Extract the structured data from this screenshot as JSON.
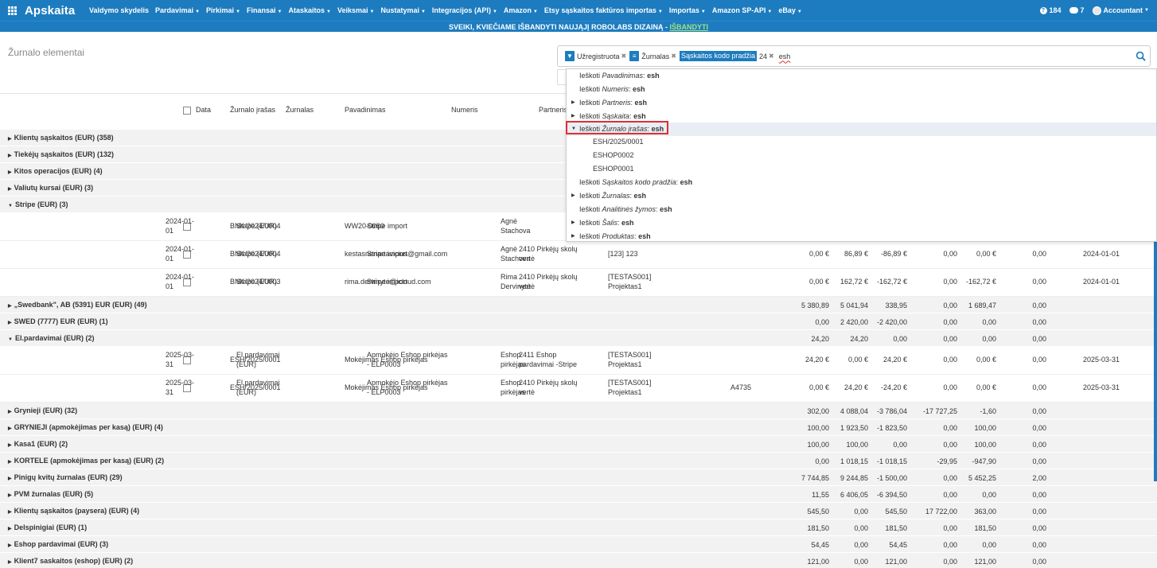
{
  "app": {
    "name": "Apskaita"
  },
  "nav": {
    "items": [
      "Valdymo skydelis",
      "Pardavimai",
      "Pirkimai",
      "Finansai",
      "Ataskaitos",
      "Veiksmai",
      "Nustatymai",
      "Integracijos (API)",
      "Amazon",
      "Etsy sąskaitos faktūros importas",
      "Importas",
      "Amazon SP-API",
      "eBay"
    ],
    "has_caret": [
      false,
      true,
      true,
      true,
      true,
      true,
      true,
      true,
      true,
      true,
      true,
      true,
      true
    ],
    "help_count": "184",
    "messages_count": "7",
    "user": "Accountant"
  },
  "promo": {
    "text": "SVEIKI, KVIEČIAME IŠBANDYTI NAUJĄJĮ ROBOLABS DIZAINĄ - ",
    "link": "IŠBANDYTI"
  },
  "page": {
    "title": "Žurnalo elementai"
  },
  "search": {
    "facets": [
      {
        "icon": "filter-icon",
        "label": "Užregistruota"
      },
      {
        "icon": "list-icon",
        "label": "Žurnalas"
      },
      {
        "icon": "groupby-label",
        "label": "Sąskaitos kodo pradžia",
        "value": "24"
      }
    ],
    "query": "esh"
  },
  "dropdown": {
    "items": [
      {
        "prefix": "Ieškoti ",
        "field": "Pavadinimas",
        "sep": ": ",
        "q": "esh",
        "expandable": false
      },
      {
        "prefix": "Ieškoti ",
        "field": "Numeris",
        "sep": ": ",
        "q": "esh",
        "expandable": false
      },
      {
        "prefix": "Ieškoti ",
        "field": "Partneris",
        "sep": ": ",
        "q": "esh",
        "expandable": true
      },
      {
        "prefix": "Ieškoti ",
        "field": "Sąskaita",
        "sep": ": ",
        "q": "esh",
        "expandable": true
      },
      {
        "prefix": "Ieškoti ",
        "field": "Žurnalo įrašas",
        "sep": ": ",
        "q": "esh",
        "expandable": true,
        "expanded": true,
        "active": true
      },
      {
        "sub": "ESH/2025/0001"
      },
      {
        "sub": "ESHOP0002"
      },
      {
        "sub": "ESHOP0001"
      },
      {
        "prefix": "Ieškoti ",
        "field": "Sąskaitos kodo pradžia",
        "sep": ": ",
        "q": "esh",
        "expandable": false
      },
      {
        "prefix": "Ieškoti ",
        "field": "Žurnalas",
        "sep": ": ",
        "q": "esh",
        "expandable": true
      },
      {
        "prefix": "Ieškoti ",
        "field": "Analitinės žymos",
        "sep": ": ",
        "q": "esh",
        "expandable": false
      },
      {
        "prefix": "Ieškoti ",
        "field": "Šalis",
        "sep": ": ",
        "q": "esh",
        "expandable": true
      },
      {
        "prefix": "Ieškoti ",
        "field": "Produktas",
        "sep": ": ",
        "q": "esh",
        "expandable": true
      }
    ]
  },
  "table": {
    "headers": {
      "date": "Data",
      "entry": "Žurnalo įrašas",
      "journal": "Žurnalas",
      "name": "Pavadinimas",
      "number": "Numeris",
      "partner": "Partneris"
    },
    "rows": [
      {
        "t": "g",
        "label": "Klientų sąskaitos (EUR) (358)",
        "open": false,
        "vals": [
          "",
          "",
          "",
          "",
          "",
          ""
        ]
      },
      {
        "t": "g",
        "label": "Tiekėjų sąskaitos (EUR) (132)",
        "open": false,
        "vals": [
          "",
          "",
          "",
          "",
          "",
          ""
        ]
      },
      {
        "t": "g",
        "label": "Kitos operacijos (EUR) (4)",
        "open": false,
        "vals": [
          "",
          "",
          "",
          "",
          "",
          ""
        ]
      },
      {
        "t": "g",
        "label": "Valiutų kursai (EUR) (3)",
        "open": false,
        "vals": [
          "",
          "",
          "",
          "",
          "",
          ""
        ]
      },
      {
        "t": "g",
        "label": "Stripe (EUR) (3)",
        "open": true,
        "vals": [
          "",
          "",
          "",
          "",
          "",
          ""
        ]
      },
      {
        "t": "d",
        "date": "2024-01-01",
        "entry": "BNK/2024/0004",
        "journal": "Stripe (EUR)",
        "name": "WW20-0060",
        "number": "Stripe import",
        "partner": "Agnė Stachova",
        "account": "",
        "analytic": "",
        "ref": "",
        "v": [
          "",
          "",
          "",
          "",
          "",
          ""
        ],
        "due": ""
      },
      {
        "t": "d",
        "date": "2024-01-01",
        "entry": "BNK/2024/0004",
        "journal": "Stripe (EUR)",
        "name": "kestasnenartavicius@gmail.com",
        "number": "Stripe import",
        "partner": "Agnė Stachova",
        "account": "2410 Pirkėjų skolų vertė",
        "analytic": "[123] 123",
        "ref": "",
        "v": [
          "0,00 €",
          "86,89 €",
          "-86,89 €",
          "0,00",
          "0,00 €",
          "0,00"
        ],
        "due": "2024-01-01"
      },
      {
        "t": "d",
        "date": "2024-01-01",
        "entry": "BNK/2024/0003",
        "journal": "Stripe (EUR)",
        "name": "rima.dervinyte@icloud.com",
        "number": "Stripe import",
        "partner": "Rima Dervinytė",
        "account": "2410 Pirkėjų skolų vertė",
        "analytic": "[TESTAS001] Projektas1",
        "ref": "",
        "v": [
          "0,00 €",
          "162,72 €",
          "-162,72 €",
          "0,00",
          "-162,72 €",
          "0,00"
        ],
        "due": "2024-01-01"
      },
      {
        "t": "g",
        "label": "„Swedbank\", AB (5391) EUR (EUR) (49)",
        "open": false,
        "vals": [
          "5 380,89",
          "5 041,94",
          "338,95",
          "0,00",
          "1 689,47",
          "0,00"
        ]
      },
      {
        "t": "g",
        "label": "SWED (7777) EUR (EUR) (1)",
        "open": false,
        "vals": [
          "0,00",
          "2 420,00",
          "-2 420,00",
          "0,00",
          "0,00",
          "0,00"
        ]
      },
      {
        "t": "g",
        "label": "El.pardavimai (EUR) (2)",
        "open": true,
        "vals": [
          "24,20",
          "24,20",
          "0,00",
          "0,00",
          "0,00",
          "0,00"
        ]
      },
      {
        "t": "d",
        "date": "2025-03-31",
        "entry": "ESH/2025/0001",
        "journal": "El.pardavimai (EUR)",
        "name": "Mokėjimas Eshop pirkėjas",
        "number": "Apmokėjo Eshop pirkėjas - ELP0003",
        "partner": "Eshop pirkėjas",
        "account": "2411 Eshop pardavimai -Stripe",
        "analytic": "[TESTAS001] Projektas1",
        "ref": "",
        "v": [
          "24,20 €",
          "0,00 €",
          "24,20 €",
          "0,00",
          "0,00 €",
          "0,00"
        ],
        "due": "2025-03-31"
      },
      {
        "t": "d",
        "date": "2025-03-31",
        "entry": "ESH/2025/0001",
        "journal": "El.pardavimai (EUR)",
        "name": "Mokėjimas Eshop pirkėjas",
        "number": "Apmokėjo Eshop pirkėjas - ELP0003",
        "partner": "Eshop pirkėjas",
        "account": "2410 Pirkėjų skolų vertė",
        "analytic": "[TESTAS001] Projektas1",
        "ref": "A4735",
        "v": [
          "0,00 €",
          "24,20 €",
          "-24,20 €",
          "0,00",
          "0,00 €",
          "0,00"
        ],
        "due": "2025-03-31"
      },
      {
        "t": "g",
        "label": "Grynieji (EUR) (32)",
        "open": false,
        "vals": [
          "302,00",
          "4 088,04",
          "-3 786,04",
          "-17 727,25",
          "-1,60",
          "0,00"
        ]
      },
      {
        "t": "g",
        "label": "GRYNIEJI (apmokėjimas per kasą) (EUR) (4)",
        "open": false,
        "vals": [
          "100,00",
          "1 923,50",
          "-1 823,50",
          "0,00",
          "100,00",
          "0,00"
        ]
      },
      {
        "t": "g",
        "label": "Kasa1 (EUR) (2)",
        "open": false,
        "vals": [
          "100,00",
          "100,00",
          "0,00",
          "0,00",
          "100,00",
          "0,00"
        ]
      },
      {
        "t": "g",
        "label": "KORTELE (apmokėjimas per kasą) (EUR) (2)",
        "open": false,
        "vals": [
          "0,00",
          "1 018,15",
          "-1 018,15",
          "-29,95",
          "-947,90",
          "0,00"
        ]
      },
      {
        "t": "g",
        "label": "Pinigų kvitų žurnalas (EUR) (29)",
        "open": false,
        "vals": [
          "7 744,85",
          "9 244,85",
          "-1 500,00",
          "0,00",
          "5 452,25",
          "2,00"
        ]
      },
      {
        "t": "g",
        "label": "PVM žurnalas (EUR) (5)",
        "open": false,
        "vals": [
          "11,55",
          "6 406,05",
          "-6 394,50",
          "0,00",
          "0,00",
          "0,00"
        ]
      },
      {
        "t": "g",
        "label": "Klientų sąskaitos (paysera) (EUR) (4)",
        "open": false,
        "vals": [
          "545,50",
          "0,00",
          "545,50",
          "17 722,00",
          "363,00",
          "0,00"
        ]
      },
      {
        "t": "g",
        "label": "Delspinigiai (EUR) (1)",
        "open": false,
        "vals": [
          "181,50",
          "0,00",
          "181,50",
          "0,00",
          "181,50",
          "0,00"
        ]
      },
      {
        "t": "g",
        "label": "Eshop pardavimai (EUR) (3)",
        "open": false,
        "vals": [
          "54,45",
          "0,00",
          "54,45",
          "0,00",
          "0,00",
          "0,00"
        ]
      },
      {
        "t": "g",
        "label": "Klient7 saskaitos (eshop) (EUR) (2)",
        "open": false,
        "vals": [
          "121,00",
          "0,00",
          "121,00",
          "0,00",
          "121,00",
          "0,00"
        ]
      }
    ]
  }
}
